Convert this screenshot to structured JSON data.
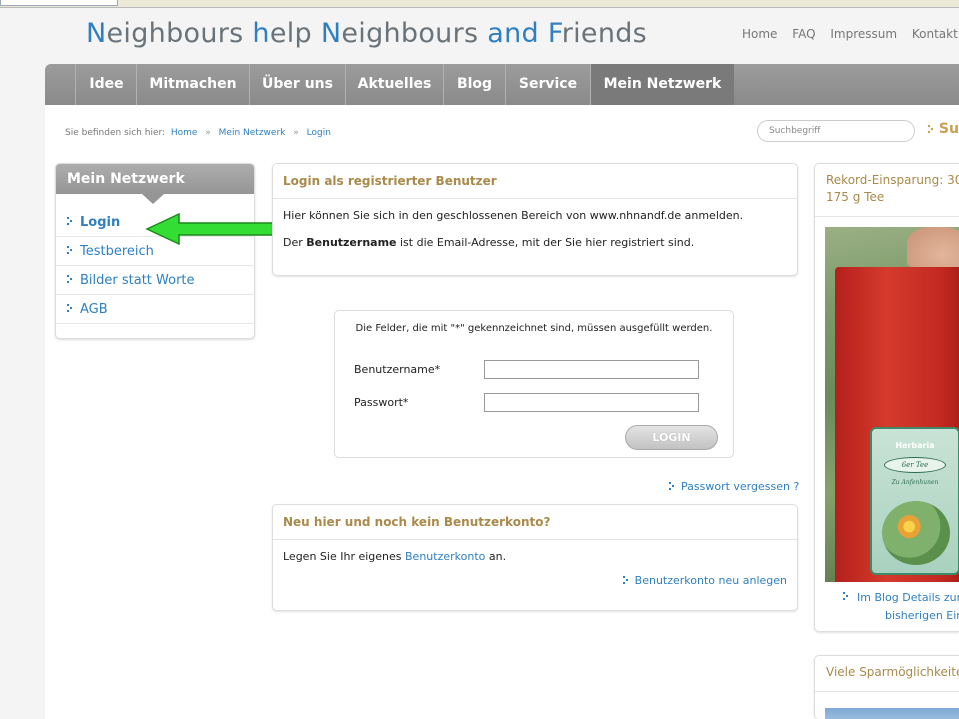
{
  "site": {
    "title_parts": [
      {
        "text": "N",
        "hl": true
      },
      {
        "text": "eighbours ",
        "hl": false
      },
      {
        "text": "h",
        "hl": true
      },
      {
        "text": "elp ",
        "hl": false
      },
      {
        "text": "N",
        "hl": true
      },
      {
        "text": "eighbours ",
        "hl": false
      },
      {
        "text": "and ",
        "hl": true
      },
      {
        "text": "F",
        "hl": true
      },
      {
        "text": "riends",
        "hl": false
      }
    ]
  },
  "top_links": [
    "Home",
    "FAQ",
    "Impressum",
    "Kontakt",
    "S"
  ],
  "nav": {
    "items": [
      "Idee",
      "Mitmachen",
      "Über uns",
      "Aktuelles",
      "Blog",
      "Service",
      "Mein Netzwerk"
    ],
    "active": "Mein Netzwerk"
  },
  "breadcrumb": {
    "prefix": "Sie befinden sich hier:",
    "items": [
      "Home",
      "Mein Netzwerk",
      "Login"
    ],
    "separator": "»"
  },
  "search": {
    "placeholder": "Suchbegriff",
    "label": "Su"
  },
  "sidebar": {
    "title": "Mein Netzwerk",
    "items": [
      {
        "label": "Login",
        "active": true
      },
      {
        "label": "Testbereich",
        "active": false
      },
      {
        "label": "Bilder statt Worte",
        "active": false
      },
      {
        "label": "AGB",
        "active": false
      }
    ]
  },
  "login_box": {
    "title": "Login als registrierter Benutzer",
    "line1": "Hier können Sie sich in den geschlossenen Bereich von www.nhnandf.de anmelden.",
    "line2_pre": "Der ",
    "line2_bold": "Benutzername",
    "line2_post": " ist die Email-Adresse, mit der Sie hier registriert sind."
  },
  "form": {
    "note": "Die Felder, die mit \"*\" gekennzeichnet sind, müssen ausgefüllt werden.",
    "username_label": "Benutzername*",
    "password_label": "Passwort*",
    "username_value": "",
    "password_value": "",
    "submit_label": "LOGIN"
  },
  "forgot_password": "Passwort vergessen ?",
  "register_box": {
    "title": "Neu hier und noch kein Benutzerkonto?",
    "text_pre": "Legen Sie Ihr eigenes ",
    "text_link": "Benutzerkonto",
    "text_post": " an.",
    "action_link": "Benutzerkonto neu anlegen"
  },
  "right_box_1": {
    "title_line1": "Rekord-Einsparung: 30",
    "title_line2": "175 g Tee",
    "photo_brand": "Herbaria",
    "photo_product": "6er Tee",
    "photo_sub": "Zu Anfenhunen",
    "caption_line1": "Im Blog Details zur",
    "caption_line2": "bisherigen Ein"
  },
  "right_box_2": {
    "title": "Viele Sparmöglichkeite"
  },
  "colors": {
    "accent_blue": "#2f7fc1",
    "heading_gold": "#a98a4a",
    "nav_gray": "#8f8f8f",
    "arrow_green": "#33dd33"
  }
}
